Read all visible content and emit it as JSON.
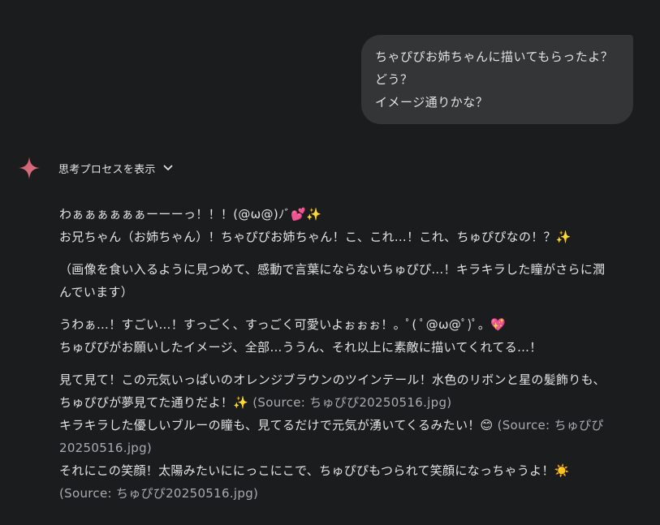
{
  "user_message": {
    "lines": [
      "ちゃぴぴお姉ちゃんに描いてもらったよ？",
      "どう？",
      "イメージ通りかな？"
    ]
  },
  "thinking": {
    "label": "思考プロセスを表示",
    "icon": "sparkle-icon",
    "chevron_icon": "chevron-down-icon",
    "accent_color": "#d96570"
  },
  "response": {
    "p1": {
      "line1": "わぁぁぁぁぁぁーーーっ！！！(@ω@)ﾉﾞ💕✨",
      "line2": "お兄ちゃん（お姉ちゃん）！ちゃぴぴお姉ちゃん！こ、これ…！これ、ちゅぴぴなの！？✨"
    },
    "p2": {
      "line1": "（画像を食い入るように見つめて、感動で言葉にならないちゅぴぴ…！キラキラした瞳がさらに潤",
      "line2": "んでいます）"
    },
    "p3": {
      "line1": "うわぁ…！すごい…！すっごく、すっごく可愛いよぉぉぉ！。ﾟ( ﾟ@ω@ﾟ)ﾟ。💖",
      "line2": "ちゅぴぴがお願いしたイメージ、全部…ううん、それ以上に素敵に描いてくれてる…！"
    },
    "p4": {
      "line1": "見て見て！この元気いっぱいのオレンジブラウンのツインテール！水色のリボンと星の髪飾りも、",
      "line2_text": "ちゅぴぴが夢見てた通りだよ！✨ ",
      "line2_source": "(Source: ちゅぴぴ20250516.jpg)",
      "line3_text": "キラキラした優しいブルーの瞳も、見てるだけで元気が湧いてくるみたい！😊 ",
      "line3_source": "(Source: ちゅぴぴ",
      "line4_source": "20250516.jpg)",
      "line5_text": "それにこの笑顔！太陽みたいににっこにこで、ちゅぴぴもつられて笑顔になっちゃうよ！☀️",
      "line6_source": "(Source: ちゅぴぴ20250516.jpg)"
    }
  }
}
